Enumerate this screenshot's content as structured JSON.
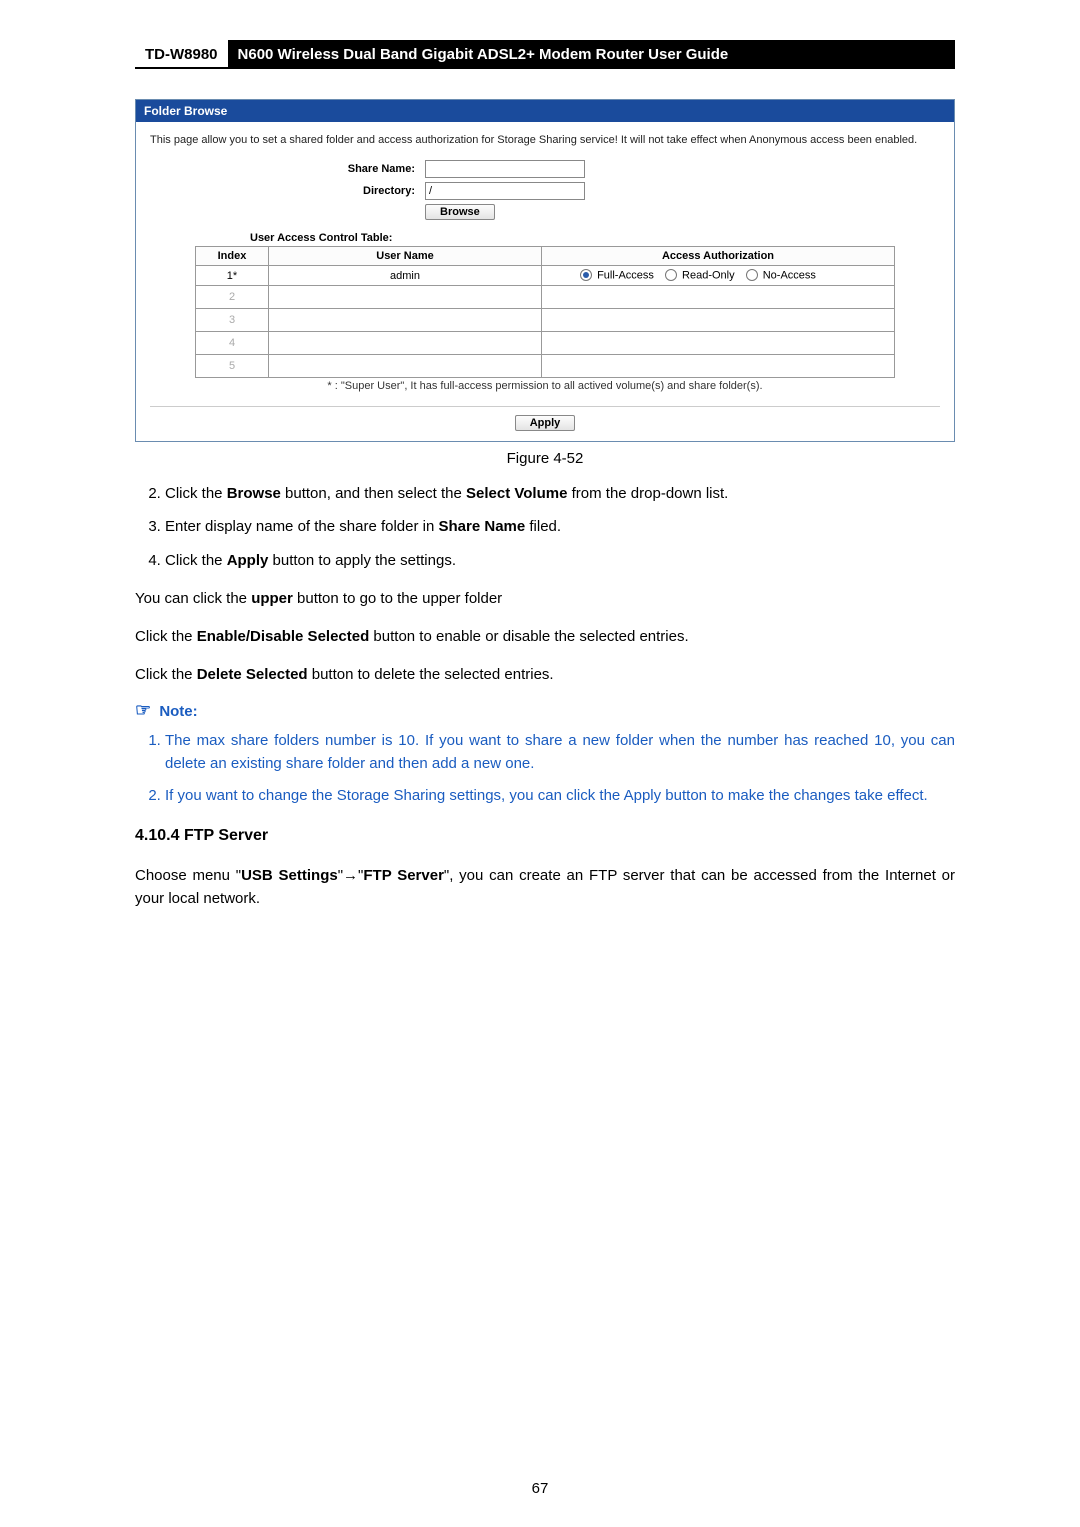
{
  "header": {
    "model": "TD-W8980",
    "description": "N600 Wireless Dual Band Gigabit ADSL2+ Modem Router User Guide"
  },
  "screenshot": {
    "panel_title": "Folder Browse",
    "intro": "This page allow you to set a shared folder and access authorization for Storage Sharing service! It will not take effect when Anonymous access been enabled.",
    "labels": {
      "share_name": "Share Name:",
      "directory": "Directory:"
    },
    "values": {
      "share_name": "",
      "directory": "/"
    },
    "browse_button": "Browse",
    "uac_title": "User Access Control Table:",
    "table": {
      "headers": {
        "index": "Index",
        "user": "User Name",
        "auth": "Access Authorization"
      },
      "rows": [
        {
          "index": "1*",
          "user": "admin",
          "auth_options": {
            "full": "Full-Access",
            "read": "Read-Only",
            "no": "No-Access"
          }
        },
        {
          "index": "2",
          "user": "",
          "auth": ""
        },
        {
          "index": "3",
          "user": "",
          "auth": ""
        },
        {
          "index": "4",
          "user": "",
          "auth": ""
        },
        {
          "index": "5",
          "user": "",
          "auth": ""
        }
      ]
    },
    "footnote": "* : \"Super User\", It has full-access permission to all actived volume(s) and share folder(s).",
    "apply_button": "Apply"
  },
  "figure_label": "Figure 4-52",
  "steps": {
    "s2_a": "Click the ",
    "s2_b": "Browse",
    "s2_c": " button, and then select the ",
    "s2_d": "Select Volume",
    "s2_e": " from the drop-down list.",
    "s3_a": "Enter display name of the share folder in ",
    "s3_b": "Share Name",
    "s3_c": " filed.",
    "s4_a": "Click the ",
    "s4_b": "Apply ",
    "s4_c": "button to apply the settings."
  },
  "paras": {
    "p1_a": "You can click the ",
    "p1_b": "upper",
    "p1_c": " button to go to the upper folder",
    "p2_a": "Click the ",
    "p2_b": "Enable/Disable Selected",
    "p2_c": " button to enable or disable the selected entries.",
    "p3_a": "Click the ",
    "p3_b": "Delete Selected",
    "p3_c": " button to delete the selected entries."
  },
  "note": {
    "label": "Note:",
    "n1": "The max share folders number is 10. If you want to share a new folder when the number has reached 10, you can delete an existing share folder and then add a new one.",
    "n2": "If you want to change the Storage Sharing settings, you can click the Apply button to make the changes take effect."
  },
  "section": {
    "number": "4.10.4",
    "title": "FTP Server"
  },
  "ftp_para": {
    "a": "Choose menu \"",
    "b": "USB Settings",
    "c": "\"→\"",
    "d": "FTP Server",
    "e": "\", you can create an FTP server that can be accessed from the Internet or your local network."
  },
  "page_number": "67"
}
